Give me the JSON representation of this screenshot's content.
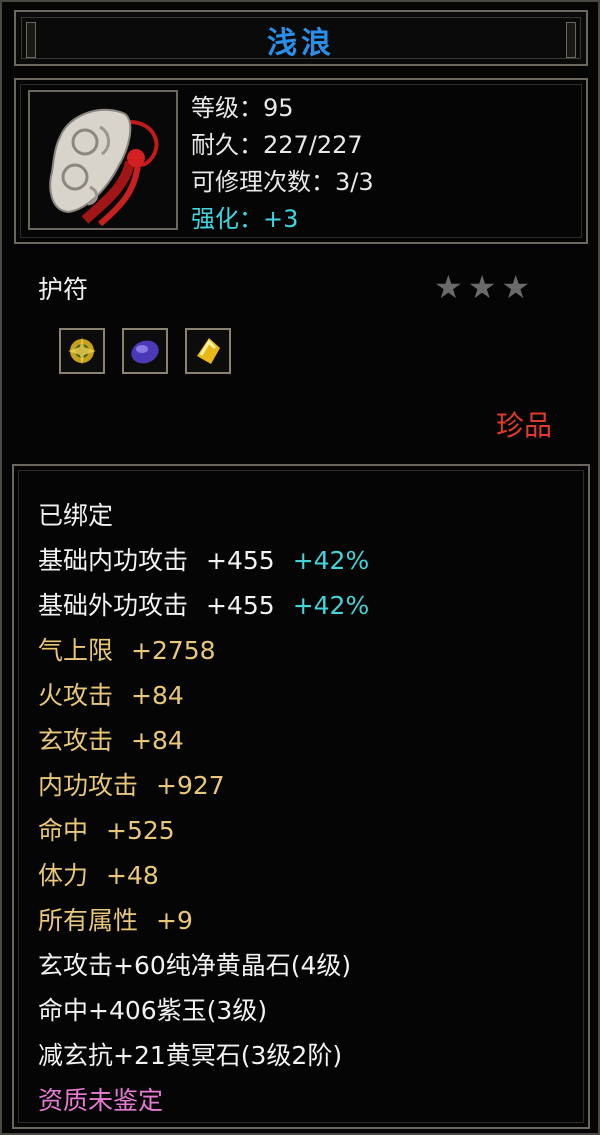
{
  "item": {
    "name": "浅浪",
    "stats": {
      "level": "等级：95",
      "durability": "耐久：227/227",
      "repairs": "可修理次数：3/3",
      "enhance": "强化：+3"
    },
    "category": "护符",
    "stars_text": "★★★",
    "star_count": 3,
    "rarity": "珍品",
    "gem_icons": [
      "gold-gem-icon",
      "purple-jade-icon",
      "yellow-crystal-icon"
    ],
    "colors": {
      "title": "#2a8fe8",
      "enhance": "#3fd6e0",
      "rarity": "#e03a2a",
      "gold_attr": "#e8c878",
      "quality": "#e77bd3",
      "bonus_percent": "#43d3d8"
    }
  },
  "attributes": {
    "bound": "已绑定",
    "base_inner": {
      "label": "基础内功攻击",
      "value": "+455",
      "bonus": "+42%"
    },
    "base_outer": {
      "label": "基础外功攻击",
      "value": "+455",
      "bonus": "+42%"
    },
    "lines": [
      {
        "label": "气上限",
        "value": "+2758"
      },
      {
        "label": "火攻击",
        "value": "+84"
      },
      {
        "label": "玄攻击",
        "value": "+84"
      },
      {
        "label": "内功攻击",
        "value": "+927"
      },
      {
        "label": "命中",
        "value": "+525"
      },
      {
        "label": "体力",
        "value": "+48"
      },
      {
        "label": "所有属性",
        "value": "+9"
      }
    ],
    "gems": [
      "玄攻击+60纯净黄晶石(4级)",
      "命中+406紫玉(3级)",
      "减玄抗+21黄冥石(3级2阶)"
    ],
    "quality": "资质未鉴定"
  }
}
